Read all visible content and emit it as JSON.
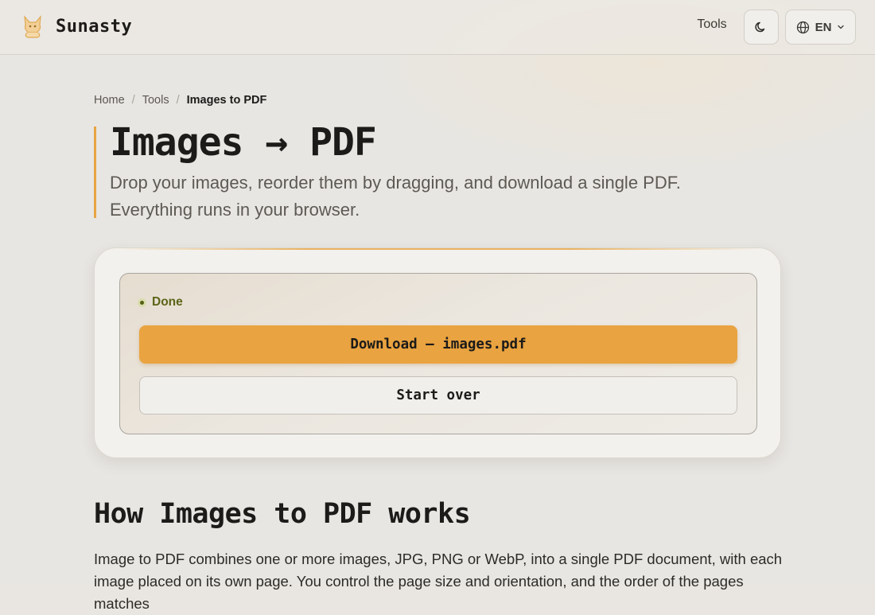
{
  "header": {
    "brand_name": "Sunasty",
    "nav_tools": "Tools",
    "theme_icon": "moon-icon",
    "language": "EN"
  },
  "breadcrumb": {
    "items": [
      "Home",
      "Tools",
      "Images to PDF"
    ]
  },
  "title": {
    "main": "Images → PDF",
    "subtitle": "Drop your images, reorder them by dragging, and download a single PDF. Everything runs in your browser."
  },
  "card": {
    "status": "Done",
    "download_label": "Download — images.pdf",
    "restart_label": "Start over"
  },
  "how": {
    "heading": "How Images to PDF works",
    "body": "Image to PDF combines one or more images, JPG, PNG or WebP, into a single PDF document, with each image placed on its own page. You control the page size and orientation, and the order of the pages matches"
  },
  "colors": {
    "accent": "#e9a340",
    "status_text": "#5b6417",
    "background": "#e8e6e2"
  }
}
